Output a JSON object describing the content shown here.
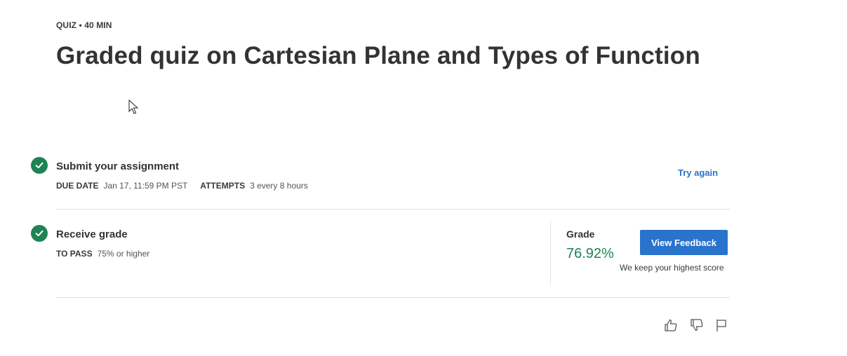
{
  "header": {
    "kicker": "QUIZ • 40 MIN",
    "title": "Graded quiz on Cartesian Plane and Types of Function"
  },
  "submit": {
    "title": "Submit your assignment",
    "due_label": "DUE DATE",
    "due_value": "Jan 17, 11:59 PM PST",
    "attempts_label": "ATTEMPTS",
    "attempts_value": "3 every 8 hours",
    "action_label": "Try again",
    "status_icon": "check-circle-icon"
  },
  "receive": {
    "title": "Receive grade",
    "pass_label": "TO PASS",
    "pass_value": "75% or higher",
    "status_icon": "check-circle-icon"
  },
  "grade": {
    "label": "Grade",
    "value": "76.92%",
    "button_label": "View Feedback",
    "note": "We keep your highest score"
  },
  "feedback_icons": [
    "thumbs-up-icon",
    "thumbs-down-icon",
    "flag-icon"
  ],
  "colors": {
    "accent": "#2a73cc",
    "success": "#1f8354",
    "text": "#333333",
    "divider": "#e1e1e1"
  }
}
